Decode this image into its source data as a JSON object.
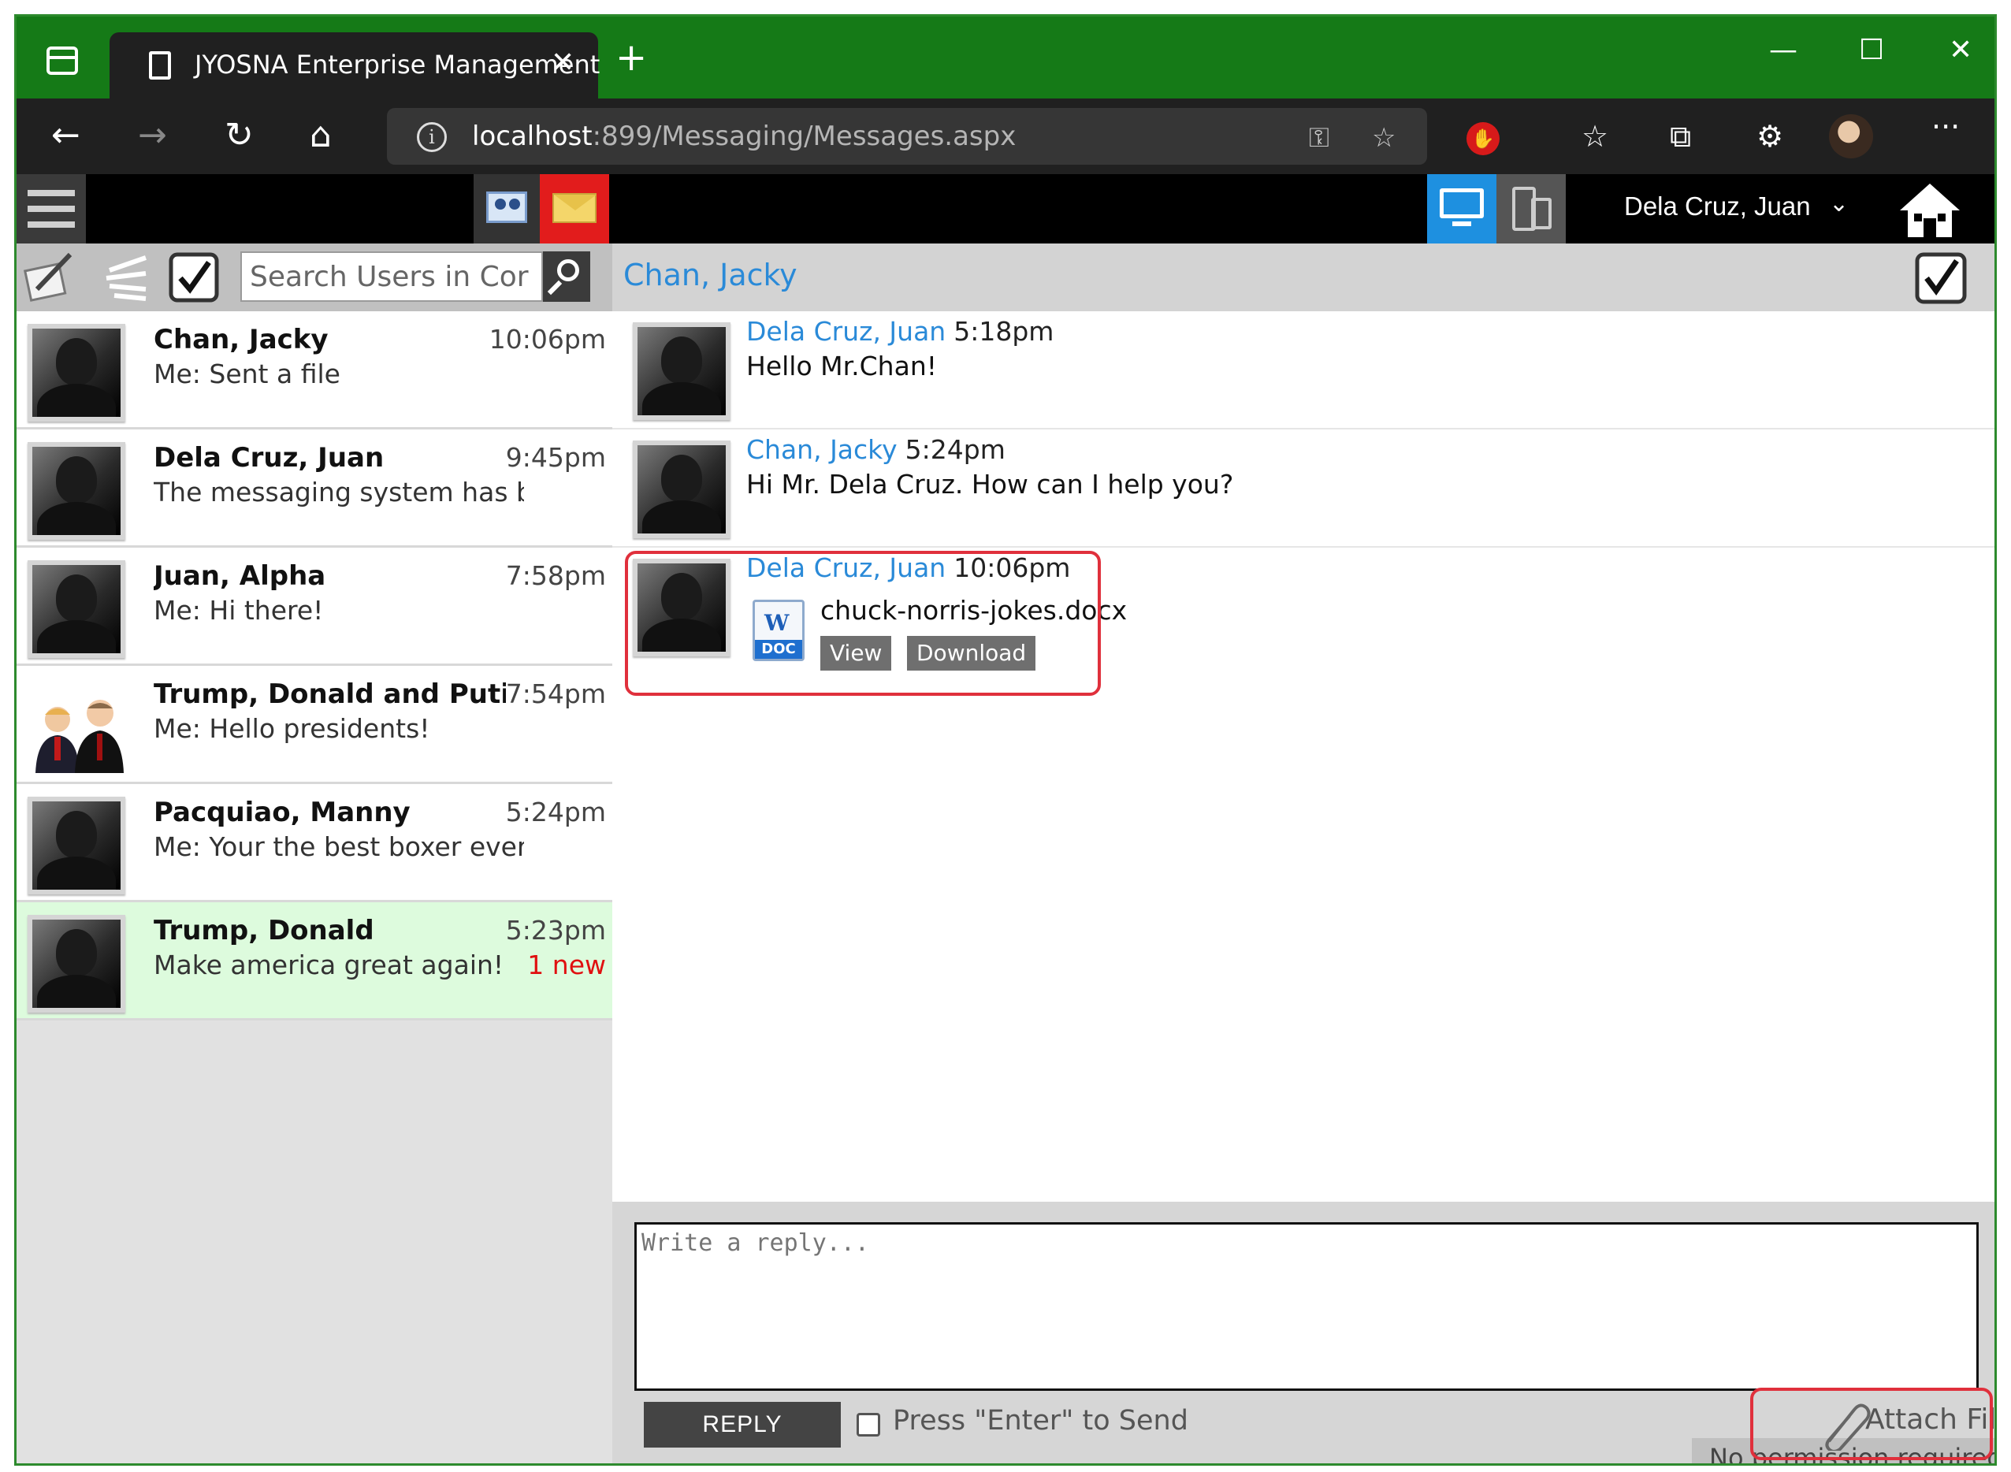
{
  "browser": {
    "tab_title": "JYOSNA Enterprise Management",
    "tab_close": "✕",
    "new_tab": "+",
    "url_host": "localhost",
    "url_path": ":899/Messaging/Messages.aspx",
    "window_minimize": "—",
    "window_maximize": "☐",
    "window_close": "✕",
    "back": "←",
    "forward": "→",
    "refresh": "↻",
    "home": "⌂",
    "more": "···"
  },
  "app": {
    "user_name": "Dela Cruz, Juan",
    "search_placeholder": "Search Users in Cor"
  },
  "conversations": [
    {
      "name": "Chan, Jacky",
      "time": "10:06pm",
      "preview": "Me: Sent a file",
      "new": "",
      "highlighted": false,
      "group": false
    },
    {
      "name": "Dela Cruz, Juan",
      "time": "9:45pm",
      "preview": "The messaging system has been u",
      "new": "",
      "highlighted": false,
      "group": false
    },
    {
      "name": "Juan, Alpha",
      "time": "7:58pm",
      "preview": "Me: Hi there!",
      "new": "",
      "highlighted": false,
      "group": false
    },
    {
      "name": "Trump, Donald and Putin, Vladi",
      "time": "7:54pm",
      "preview": "Me: Hello presidents!",
      "new": "",
      "highlighted": false,
      "group": true
    },
    {
      "name": "Pacquiao, Manny",
      "time": "5:24pm",
      "preview": "Me: Your the best boxer ever!",
      "new": "",
      "highlighted": false,
      "group": false
    },
    {
      "name": "Trump, Donald",
      "time": "5:23pm",
      "preview": "Make america great again!",
      "new": "1 new",
      "highlighted": true,
      "group": false
    }
  ],
  "chat": {
    "title": "Chan, Jacky",
    "messages": [
      {
        "from": "Dela Cruz, Juan",
        "time": "5:18pm",
        "text": "Hello Mr.Chan!"
      },
      {
        "from": "Chan, Jacky",
        "time": "5:24pm",
        "text": "Hi Mr. Dela Cruz. How can I help you?"
      },
      {
        "from": "Dela Cruz, Juan",
        "time": "10:06pm",
        "file": "chuck-norris-jokes.docx",
        "file_type": "DOC",
        "view_label": "View",
        "download_label": "Download"
      }
    ]
  },
  "reply": {
    "placeholder": "Write a reply...",
    "button": "REPLY",
    "enter_to_send": "Press \"Enter\" to Send",
    "attach": "Attach File",
    "permission": "No permission required"
  },
  "colors": {
    "titlebar": "#157a17",
    "link": "#2a8ad8",
    "new_badge": "#e01010",
    "highlight_row": "#ddfbdd",
    "annotation": "#e0303c"
  }
}
